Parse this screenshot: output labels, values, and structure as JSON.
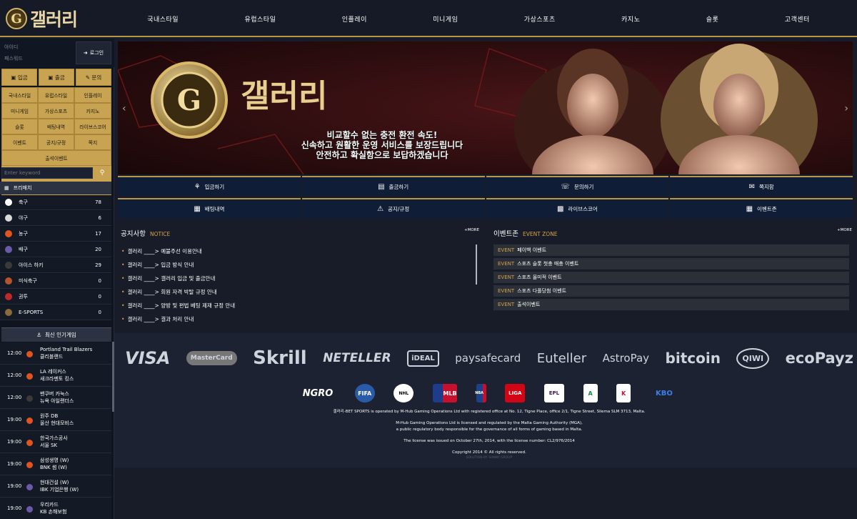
{
  "brand": {
    "logo_letter": "G",
    "logo_text": "갤러리"
  },
  "nav": [
    "국내스타일",
    "유럽스타일",
    "인플레이",
    "미니게임",
    "가상스포츠",
    "카지노",
    "슬롯",
    "고객센터"
  ],
  "login": {
    "id_placeholder": "아이디",
    "pw_placeholder": "패스워드",
    "button": "로그인"
  },
  "quick": [
    "입금",
    "출금",
    "문의"
  ],
  "menu": [
    "국내스타일",
    "유럽스타일",
    "인플레이",
    "미니게임",
    "가상스포츠",
    "카지노",
    "슬롯",
    "배팅내역",
    "라이브스코어",
    "이벤트",
    "공지/규정",
    "쪽지",
    "출석이벤트"
  ],
  "search": {
    "placeholder": "Enter keyword"
  },
  "sports_head": "프리매치",
  "sports": [
    {
      "name": "축구",
      "count": "78",
      "color": "#ffffff"
    },
    {
      "name": "야구",
      "count": "6",
      "color": "#d9d9d9"
    },
    {
      "name": "농구",
      "count": "17",
      "color": "#e0541f"
    },
    {
      "name": "배구",
      "count": "20",
      "color": "#6b5aa8"
    },
    {
      "name": "아이스 하키",
      "count": "29",
      "color": "#3a3a3a"
    },
    {
      "name": "미식축구",
      "count": "0",
      "color": "#b5542a"
    },
    {
      "name": "권투",
      "count": "0",
      "color": "#c22828"
    },
    {
      "name": "E-SPORTS",
      "count": "0",
      "color": "#8c6a3a"
    }
  ],
  "popular_head": "최신 인기게임",
  "games": [
    {
      "time": "12:00",
      "home": "Portland Trail Blazers",
      "away": "클리블랜드",
      "color": "#e0541f"
    },
    {
      "time": "12:00",
      "home": "LA 레이커스",
      "away": "새크라멘토 킹스",
      "color": "#e0541f"
    },
    {
      "time": "12:00",
      "home": "밴쿠버 카눅스",
      "away": "뉴욕 아일랜더스",
      "color": "#3a3a3a"
    },
    {
      "time": "19:00",
      "home": "원주 DB",
      "away": "울산 현대모비스",
      "color": "#e0541f"
    },
    {
      "time": "19:00",
      "home": "한국가스공사",
      "away": "서울 SK",
      "color": "#e0541f"
    },
    {
      "time": "19:00",
      "home": "삼성생명 (W)",
      "away": "BNK 썸 (W)",
      "color": "#e0541f"
    },
    {
      "time": "19:00",
      "home": "현대건설 (W)",
      "away": "IBK 기업은행 (W)",
      "color": "#6b5aa8"
    },
    {
      "time": "19:00",
      "home": "우리카드",
      "away": "KB 손해보험",
      "color": "#6b5aa8"
    }
  ],
  "banner": {
    "title": "갤러리",
    "lines": [
      "비교할수 없는 충전 환전 속도!",
      "신속하고 원활한 운영 서비스를 보장드립니다",
      "안전하고 확실함으로 보답하겠습니다"
    ]
  },
  "actions_row1": [
    "입금하기",
    "출금하기",
    "문의하기",
    "쪽지함"
  ],
  "actions_row2": [
    "배팅내역",
    "공지/규정",
    "라이브스코어",
    "이벤트존"
  ],
  "notice": {
    "title": "공지사항",
    "sub": "NOTICE",
    "more": "+MORE",
    "items": [
      "갤러리 ____> 예불주선 이용안내",
      "갤러리 ____> 입금 방식 안내",
      "갤러리 ____> 갤러리 입금 및 출금안내",
      "갤러리 ____> 회원 자격 박탈 규정 안내",
      "갤러리 ____> 양방 및 편법 베팅 제재 규정 안내",
      "갤러리 ____> 결과 처리 안내"
    ]
  },
  "events": {
    "title": "이벤트존",
    "sub": "EVENT ZONE",
    "more": "+MORE",
    "tag": "EVENT",
    "items": [
      "페이백 이벤트",
      "스포츠 슬롯 첫충 매충 이벤트",
      "스포츠 올미적 이벤트",
      "스포츠 다폴당첨 이벤트",
      "출석이벤트"
    ]
  },
  "payments": [
    "VISA",
    "MasterCard",
    "Skrill",
    "NETELLER",
    "iDEAL",
    "paysafecard",
    "Euteller",
    "AstroPay",
    "bitcoin",
    "QIWI",
    "ecoPayz"
  ],
  "leagues": [
    {
      "label": "NGRO",
      "color": "#ffffff"
    },
    {
      "label": "FIFA",
      "color": "#2a5ba8"
    },
    {
      "label": "NHL",
      "color": "#ffffff"
    },
    {
      "label": "MLB",
      "color": "#c8102e"
    },
    {
      "label": "NBA",
      "color": "#1d428a"
    },
    {
      "label": "LIGA",
      "color": "#d20515"
    },
    {
      "label": "EPL",
      "color": "#3d195b"
    },
    {
      "label": "A",
      "color": "#1a8a3a"
    },
    {
      "label": "K",
      "color": "#c8102e"
    },
    {
      "label": "KBO",
      "color": "#1a4ea8"
    }
  ],
  "footer": {
    "line1": "갤러리-BET SPORTS is operated by M-Hub Gaming Operations Ltd with registered office at No. 12, Tigne Place, office 2/1, Tigne Street, Sliema SLM 3713, Malta.",
    "line2": "M-Hub Gaming Operations Ltd is licensed and regulated by the Malta Gaming Authority (MGA),",
    "line3": "a public regulatory body responsible for the governance of all forms of gaming based in Malta.",
    "line4": "The license was issued on October 27th, 2014, with the license number: CL2/976/2014",
    "line5": "Copyright 2014 © All rights reserved.",
    "line6": "SOLUTION BY SUNNY GROUP"
  }
}
